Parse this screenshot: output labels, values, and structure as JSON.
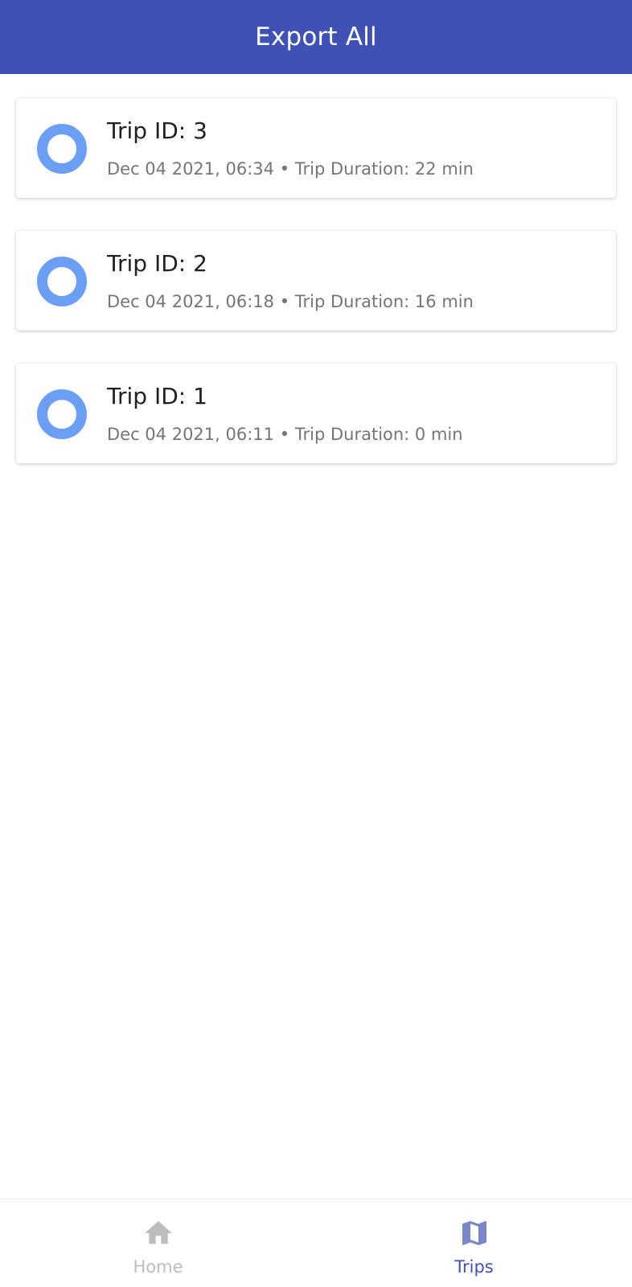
{
  "header": {
    "title": "Export All",
    "background": "#3f51b5"
  },
  "trips": [
    {
      "title": "Trip ID: 3",
      "subtitle": "Dec 04 2021, 06:34 • Trip Duration: 22 min",
      "icon": "ring-icon"
    },
    {
      "title": "Trip ID: 2",
      "subtitle": "Dec 04 2021, 06:18 • Trip Duration: 16 min",
      "icon": "ring-icon"
    },
    {
      "title": "Trip ID: 1",
      "subtitle": "Dec 04 2021, 06:11 • Trip Duration: 0 min",
      "icon": "ring-icon"
    }
  ],
  "nav": {
    "items": [
      {
        "label": "Home",
        "icon": "home-icon",
        "active": false
      },
      {
        "label": "Trips",
        "icon": "map-icon",
        "active": true
      }
    ]
  },
  "colors": {
    "accent": "#3f51b5",
    "ring": "#6b9ef5",
    "inactive": "#bdbdbd"
  }
}
